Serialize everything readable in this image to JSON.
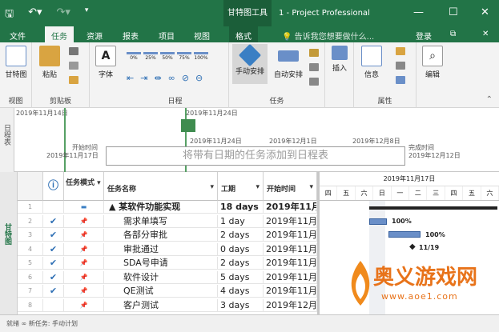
{
  "titlebar": {
    "tools_label": "甘特图工具",
    "title": "1 - Project Professional",
    "save_icon": "save-icon",
    "undo_icon": "undo-icon",
    "redo_icon": "redo-icon"
  },
  "tabs": [
    {
      "label": "文件"
    },
    {
      "label": "任务"
    },
    {
      "label": "资源"
    },
    {
      "label": "报表"
    },
    {
      "label": "项目"
    },
    {
      "label": "视图"
    },
    {
      "label": "格式"
    }
  ],
  "tell_me": "告诉我您想要做什么...",
  "login": "登录",
  "ribbon": {
    "view": {
      "btn": "甘特图",
      "group": "视图"
    },
    "clipboard": {
      "btn": "粘贴",
      "group": "剪贴板"
    },
    "font": {
      "btn": "字体"
    },
    "schedule": {
      "group": "日程",
      "pcts": [
        "0%",
        "25%",
        "50%",
        "75%",
        "100%"
      ]
    },
    "tasks": {
      "manual": "手动安排",
      "auto": "自动安排",
      "group": "任务"
    },
    "insert": {
      "btn": "插入"
    },
    "properties": {
      "info": "信息",
      "group": "属性"
    },
    "editing": {
      "btn": "编辑"
    }
  },
  "timeline": {
    "side_label": "日程表",
    "date_top_left": "2019年11月14日",
    "date_top_mid": "2019年11月24日",
    "start_label": "开始时间",
    "start_date": "2019年11月17日",
    "tick1": "2019年11月24日",
    "tick2": "2019年12月1日",
    "tick3": "2019年12月8日",
    "end_label": "完成时间",
    "end_date": "2019年12月12日",
    "placeholder": "将带有日期的任务添加到日程表"
  },
  "grid": {
    "side_label": "甘特图",
    "headers": {
      "mode": "任务模式",
      "name": "任务名称",
      "duration": "工期",
      "start": "开始时间"
    },
    "rows": [
      {
        "num": "1",
        "check": "",
        "name": "▲ 某软件功能实现",
        "duration": "18 days",
        "start": "2019年11月"
      },
      {
        "num": "2",
        "check": "✔",
        "name": "需求单填写",
        "duration": "1 day",
        "start": "2019年11月"
      },
      {
        "num": "3",
        "check": "✔",
        "name": "各部分审批",
        "duration": "2 days",
        "start": "2019年11月"
      },
      {
        "num": "4",
        "check": "✔",
        "name": "审批通过",
        "duration": "0 days",
        "start": "2019年11月"
      },
      {
        "num": "5",
        "check": "✔",
        "name": "SDA号申请",
        "duration": "2 days",
        "start": "2019年11月"
      },
      {
        "num": "6",
        "check": "✔",
        "name": "软件设计",
        "duration": "5 days",
        "start": "2019年11月"
      },
      {
        "num": "7",
        "check": "✔",
        "name": "QE测试",
        "duration": "4 days",
        "start": "2019年11月"
      },
      {
        "num": "8",
        "check": "",
        "name": "客户测试",
        "duration": "3 days",
        "start": "2019年12月"
      }
    ]
  },
  "gantt": {
    "header_date": "2019年11月17日",
    "days": [
      "四",
      "五",
      "六",
      "日",
      "一",
      "二",
      "三",
      "四",
      "五",
      "六"
    ],
    "labels": [
      "100%",
      "100%",
      "11/19"
    ]
  },
  "status": {
    "text": "就绪   ∞ 新任务: 手动计划"
  },
  "watermark": {
    "text": "奥义游戏网",
    "url": "www.aoe1.com"
  },
  "colors": {
    "accent": "#227447",
    "bar": "#6a8fc8"
  }
}
